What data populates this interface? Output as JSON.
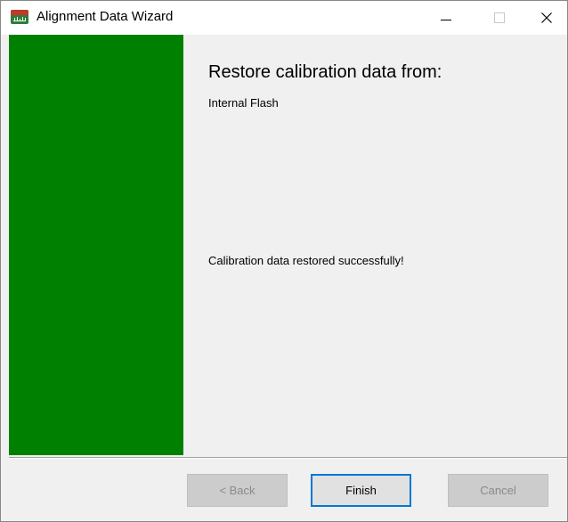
{
  "window": {
    "title": "Alignment Data Wizard",
    "icon": "app-chart-icon"
  },
  "titlebar_controls": {
    "minimize_icon": "minimize-icon",
    "maximize_icon": "maximize-icon",
    "close_icon": "close-icon"
  },
  "side_panel": {
    "color": "#008000"
  },
  "main": {
    "heading": "Restore calibration data from:",
    "source": "Internal Flash",
    "status": "Calibration data restored successfully!"
  },
  "buttons": {
    "back_label": "< Back",
    "finish_label": "Finish",
    "cancel_label": "Cancel",
    "back_enabled": false,
    "finish_enabled": true,
    "cancel_enabled": false
  },
  "colors": {
    "accent": "#0078d7",
    "panel_green": "#008000",
    "dialog_bg": "#f0f0f0"
  }
}
